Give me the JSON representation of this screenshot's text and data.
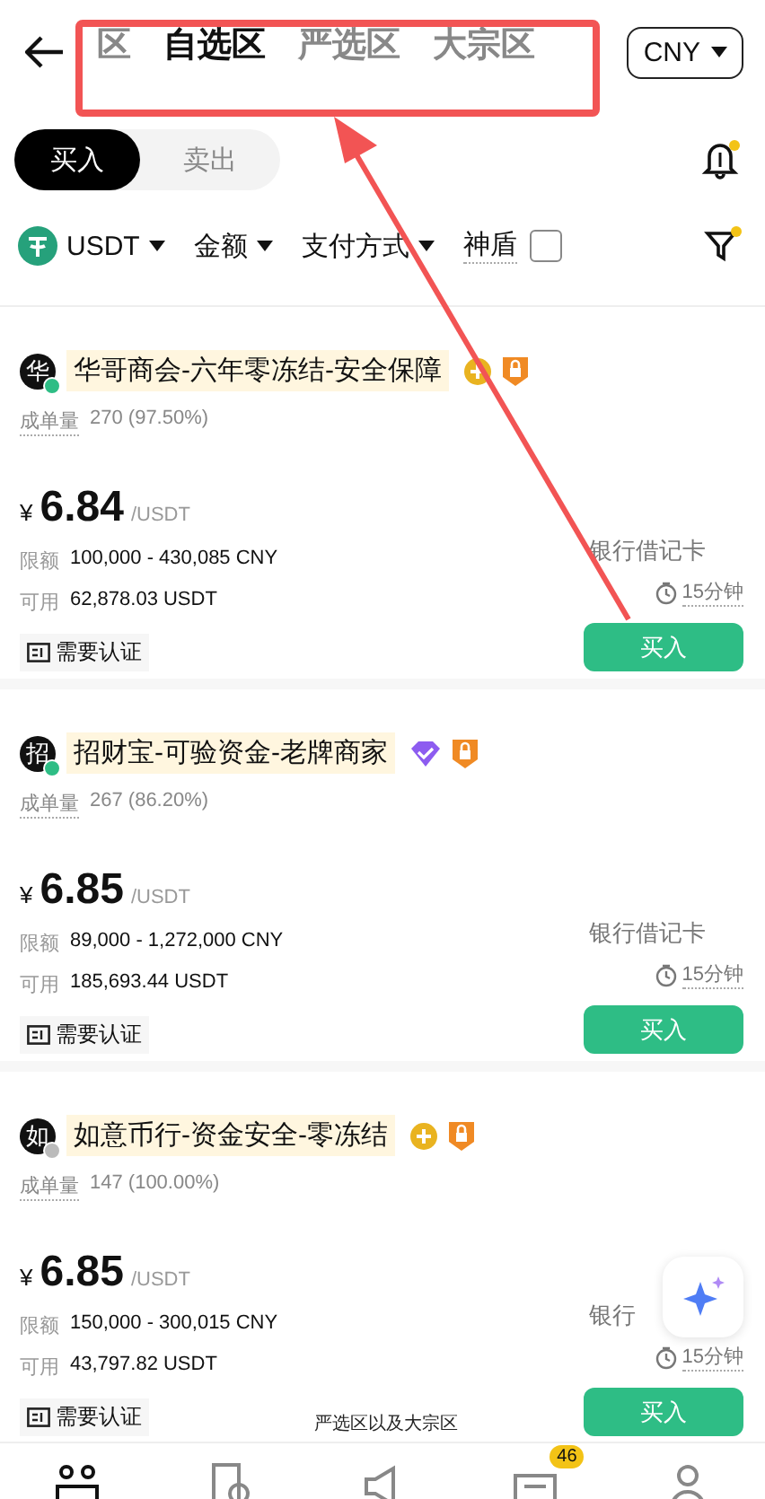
{
  "header": {
    "tabs": [
      {
        "label": "区",
        "selected": false
      },
      {
        "label": "自选区",
        "selected": true
      },
      {
        "label": "严选区",
        "selected": false
      },
      {
        "label": "大宗区",
        "selected": false
      }
    ],
    "currency": "CNY"
  },
  "sides": [
    {
      "label": "买入",
      "selected": true
    },
    {
      "label": "卖出",
      "selected": false
    }
  ],
  "filters": [
    {
      "kind": "coin",
      "label": "USDT"
    },
    {
      "kind": "dropdown",
      "label": "金额"
    },
    {
      "kind": "dropdown",
      "label": "支付方式"
    },
    {
      "kind": "checkbox",
      "label": "神盾",
      "checked": false
    }
  ],
  "listings": [
    {
      "avatar": "华",
      "online": true,
      "name": "华哥商会-六年零冻结-安全保障",
      "badge": {
        "kind": "coin"
      },
      "orders_label": "成单量",
      "orders": "270 (97.50%)",
      "symbol": "¥",
      "price": "6.84",
      "unit": "/USDT",
      "limit_label": "限额",
      "limit": "100,000 - 430,085 CNY",
      "available_label": "可用",
      "available": "62,878.03 USDT",
      "payment": "银行借记卡",
      "time": "15分钟",
      "verify": "需要认证",
      "action": "买入"
    },
    {
      "avatar": "招",
      "online": true,
      "name": "招财宝-可验资金-老牌商家",
      "badge": {
        "kind": "diamond"
      },
      "orders_label": "成单量",
      "orders": "267 (86.20%)",
      "symbol": "¥",
      "price": "6.85",
      "unit": "/USDT",
      "limit_label": "限额",
      "limit": "89,000 - 1,272,000 CNY",
      "available_label": "可用",
      "available": "185,693.44 USDT",
      "payment": "银行借记卡",
      "time": "15分钟",
      "verify": "需要认证",
      "action": "买入"
    },
    {
      "avatar": "如",
      "online": false,
      "name": "如意币行-资金安全-零冻结",
      "badge": {
        "kind": "coin"
      },
      "orders_label": "成单量",
      "orders": "147 (100.00%)",
      "symbol": "¥",
      "price": "6.85",
      "unit": "/USDT",
      "limit_label": "限额",
      "limit": "150,000 - 300,015 CNY",
      "available_label": "可用",
      "available": "43,797.82 USDT",
      "payment": "银行",
      "time": "15分钟",
      "verify": "需要认证",
      "action": "买入"
    }
  ],
  "caption": "严选区以及大宗区",
  "nav": [
    {
      "kind": "people",
      "selected": true
    },
    {
      "kind": "orders",
      "selected": false
    },
    {
      "kind": "megaphone",
      "selected": false
    },
    {
      "kind": "chat",
      "selected": false,
      "badge": "46"
    },
    {
      "kind": "profile",
      "selected": false
    }
  ]
}
